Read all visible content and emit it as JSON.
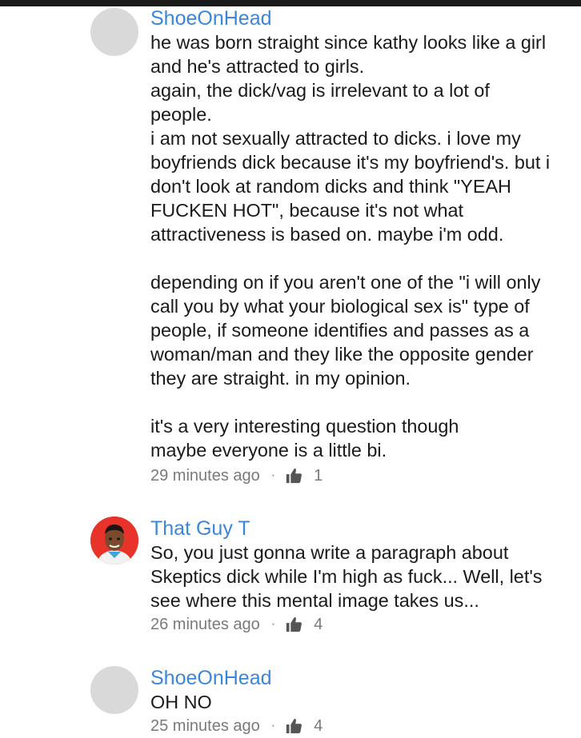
{
  "comments": [
    {
      "author": "ShoeOnHead",
      "lines": [
        "he was born straight since kathy looks like a girl",
        "and he's attracted to girls.",
        "again, the dick/vag is irrelevant to a lot of",
        "people.",
        "i am not sexually attracted to dicks. i love my",
        "boyfriends dick because it's my boyfriend's. but i",
        "don't look at random dicks and think \"YEAH",
        "FUCKEN HOT\", because it's not what",
        "attractiveness is based on. maybe i'm odd.",
        "",
        "depending on if you aren't one of the \"i will only",
        "call you by what your biological sex is\" type of",
        "people, if someone identifies and passes as a",
        "woman/man and they like the opposite gender",
        "they are straight. in my opinion.",
        "",
        "it's a very interesting question though",
        "maybe everyone is a little bi."
      ],
      "time": "29 minutes ago",
      "dot": "·",
      "likes": "1"
    },
    {
      "author": "That Guy T",
      "lines": [
        "So, you just gonna write a paragraph about",
        "Skeptics dick while I'm high as fuck... Well, let's",
        "see where this mental image takes us..."
      ],
      "time": "26 minutes ago",
      "dot": "·",
      "likes": "4"
    },
    {
      "author": "ShoeOnHead",
      "lines": [
        "OH NO"
      ],
      "time": "25 minutes ago",
      "dot": "·",
      "likes": "4"
    }
  ],
  "colors": {
    "author": "#3b86d9",
    "text": "#1a1a1a",
    "meta": "#7a7a7a",
    "avatar_placeholder": "#d9d9d9"
  }
}
